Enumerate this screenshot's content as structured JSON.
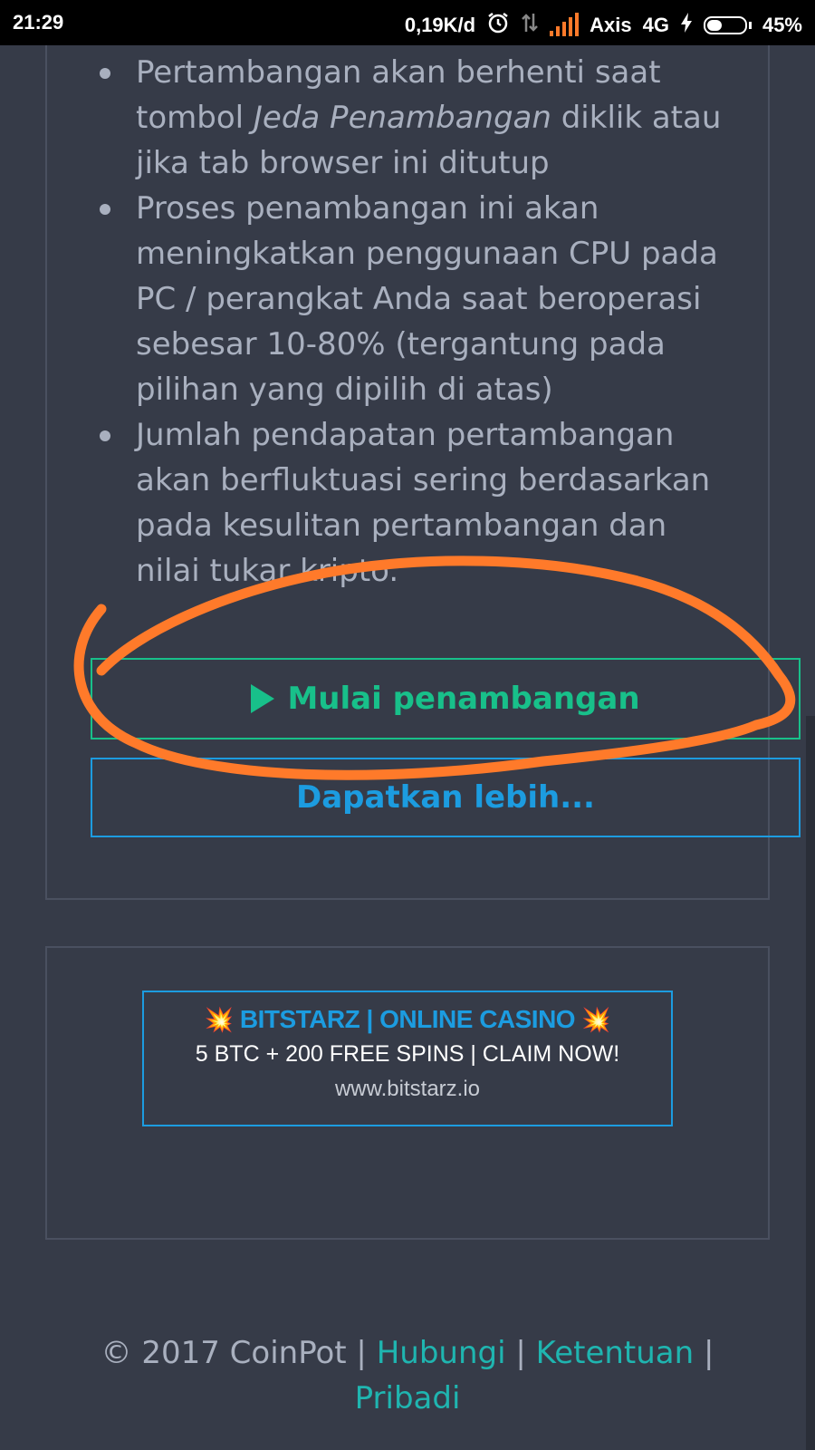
{
  "status_bar": {
    "time": "21:29",
    "net_speed": "0,19K/d",
    "carrier": "Axis",
    "network": "4G",
    "battery": "45%",
    "battery_level": 0.45,
    "icons": [
      "alarm-icon",
      "data-transfer-icon",
      "signal-icon",
      "charging-icon",
      "battery-icon"
    ]
  },
  "notes": {
    "item1_pre": "Pertambangan akan berhenti saat tombol ",
    "item1_em": "Jeda Penambangan",
    "item1_post": " diklik atau jika tab browser ini ditutup",
    "item2": "Proses penambangan ini akan meningkatkan penggunaan CPU pada PC / perangkat Anda saat beroperasi sebesar 10-80% (tergantung pada pilihan yang dipilih di atas)",
    "item3": "Jumlah pendapatan pertambangan akan berfluktuasi sering berdasarkan pada kesulitan pertambangan dan nilai tukar kripto."
  },
  "buttons": {
    "start_mining": "Mulai penambangan",
    "get_more": "Dapatkan lebih..."
  },
  "ad": {
    "title": "BITSTARZ | ONLINE CASINO",
    "subtitle": "5 BTC + 200 FREE SPINS | CLAIM NOW!",
    "url": "www.bitstarz.io",
    "emoji": "💥"
  },
  "footer": {
    "copyright": "© 2017 CoinPot | ",
    "link_contact": "Hubungi",
    "sep1": " | ",
    "link_terms": "Ketentuan",
    "sep2": " |",
    "link_privacy": "Pribadi"
  },
  "colors": {
    "background": "#363b48",
    "text_muted": "#a9b0bf",
    "start_green": "#18c08a",
    "link_blue": "#1c9ce0",
    "footer_teal": "#1fb5b0",
    "annotation_orange": "#ff7a2a"
  }
}
